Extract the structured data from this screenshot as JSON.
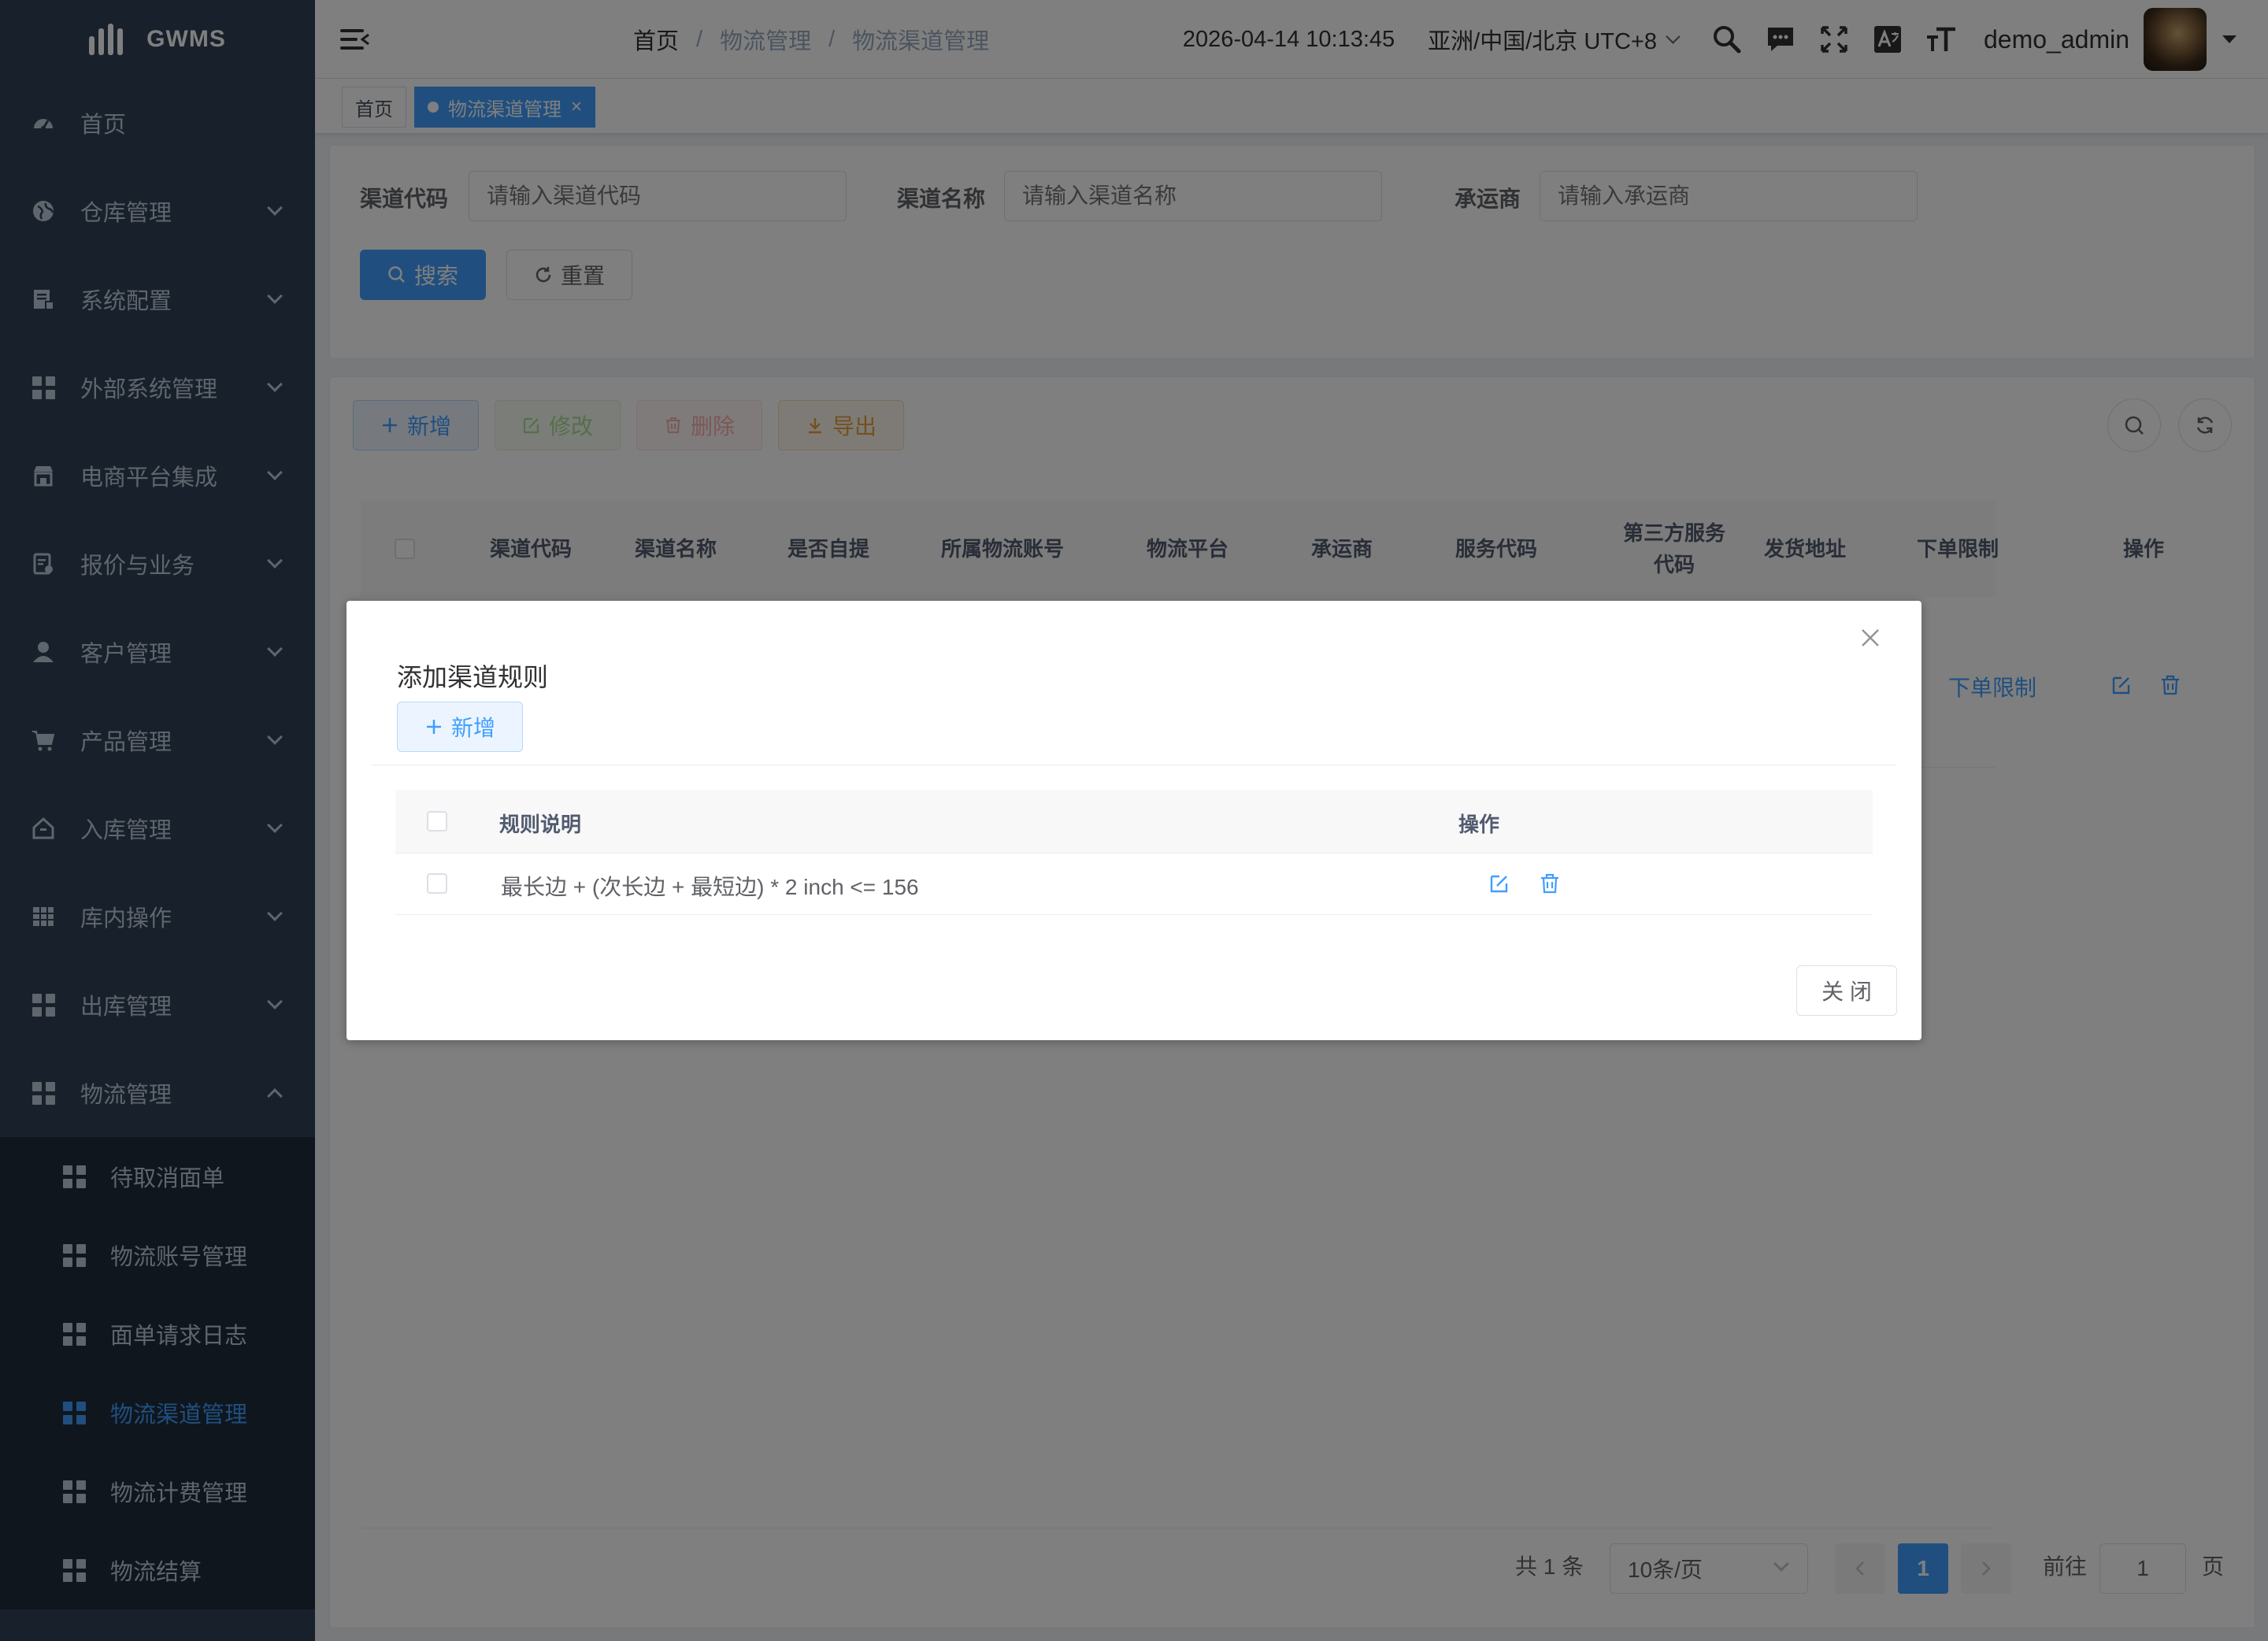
{
  "app": {
    "name": "GWMS"
  },
  "sidebar": {
    "items": [
      {
        "label": "首页",
        "icon": "dashboard-icon",
        "expandable": false
      },
      {
        "label": "仓库管理",
        "icon": "globe-icon",
        "expandable": true
      },
      {
        "label": "系统配置",
        "icon": "report-icon",
        "expandable": true
      },
      {
        "label": "外部系统管理",
        "icon": "grid-icon",
        "expandable": true
      },
      {
        "label": "电商平台集成",
        "icon": "shop-icon",
        "expandable": true
      },
      {
        "label": "报价与业务",
        "icon": "document-icon",
        "expandable": true
      },
      {
        "label": "客户管理",
        "icon": "user-icon",
        "expandable": true
      },
      {
        "label": "产品管理",
        "icon": "cart-icon",
        "expandable": true
      },
      {
        "label": "入库管理",
        "icon": "home-icon",
        "expandable": true
      },
      {
        "label": "库内操作",
        "icon": "table-icon",
        "expandable": true
      },
      {
        "label": "出库管理",
        "icon": "grid-icon",
        "expandable": true
      },
      {
        "label": "物流管理",
        "icon": "grid-icon",
        "expandable": true,
        "expanded": true
      }
    ],
    "submenu": [
      {
        "label": "待取消面单",
        "active": false
      },
      {
        "label": "物流账号管理",
        "active": false
      },
      {
        "label": "面单请求日志",
        "active": false
      },
      {
        "label": "物流渠道管理",
        "active": true
      },
      {
        "label": "物流计费管理",
        "active": false
      },
      {
        "label": "物流结算",
        "active": false
      }
    ]
  },
  "navbar": {
    "breadcrumb": [
      "首页",
      "物流管理",
      "物流渠道管理"
    ],
    "datetime": "2026-04-14 10:13:45",
    "timezone": "亚洲/中国/北京 UTC+8",
    "username": "demo_admin"
  },
  "tags": [
    {
      "label": "首页",
      "active": false
    },
    {
      "label": "物流渠道管理",
      "active": true,
      "close": "×"
    }
  ],
  "search_form": {
    "fields": [
      {
        "label": "渠道代码",
        "placeholder": "请输入渠道代码"
      },
      {
        "label": "渠道名称",
        "placeholder": "请输入渠道名称"
      },
      {
        "label": "承运商",
        "placeholder": "请输入承运商"
      }
    ],
    "search_label": "搜索",
    "reset_label": "重置"
  },
  "toolbar": {
    "add_label": "新增",
    "edit_label": "修改",
    "delete_label": "删除",
    "export_label": "导出"
  },
  "table": {
    "columns": [
      "渠道代码",
      "渠道名称",
      "是否自提",
      "所属物流账号",
      "物流平台",
      "承运商",
      "服务代码",
      "第三方服务代码",
      "发货地址",
      "下单限制",
      "操作"
    ],
    "row_link": "下单限制"
  },
  "pagination": {
    "total_text": "共 1 条",
    "page_size": "10条/页",
    "current_page": "1",
    "goto_label": "前往",
    "goto_value": "1",
    "page_suffix": "页"
  },
  "dialog": {
    "title": "添加渠道规则",
    "add_label": "新增",
    "columns": [
      "规则说明",
      "操作"
    ],
    "rows": [
      {
        "rule": "最长边 +  (次长边 + 最短边) * 2 inch <= 156"
      }
    ],
    "close_label": "关 闭"
  },
  "colors": {
    "primary": "#409eff",
    "sidebar_bg": "#304156",
    "submenu_bg": "#1f2d3d",
    "success": "#67c23a",
    "danger": "#f56c6c",
    "warning": "#e6a23c"
  }
}
